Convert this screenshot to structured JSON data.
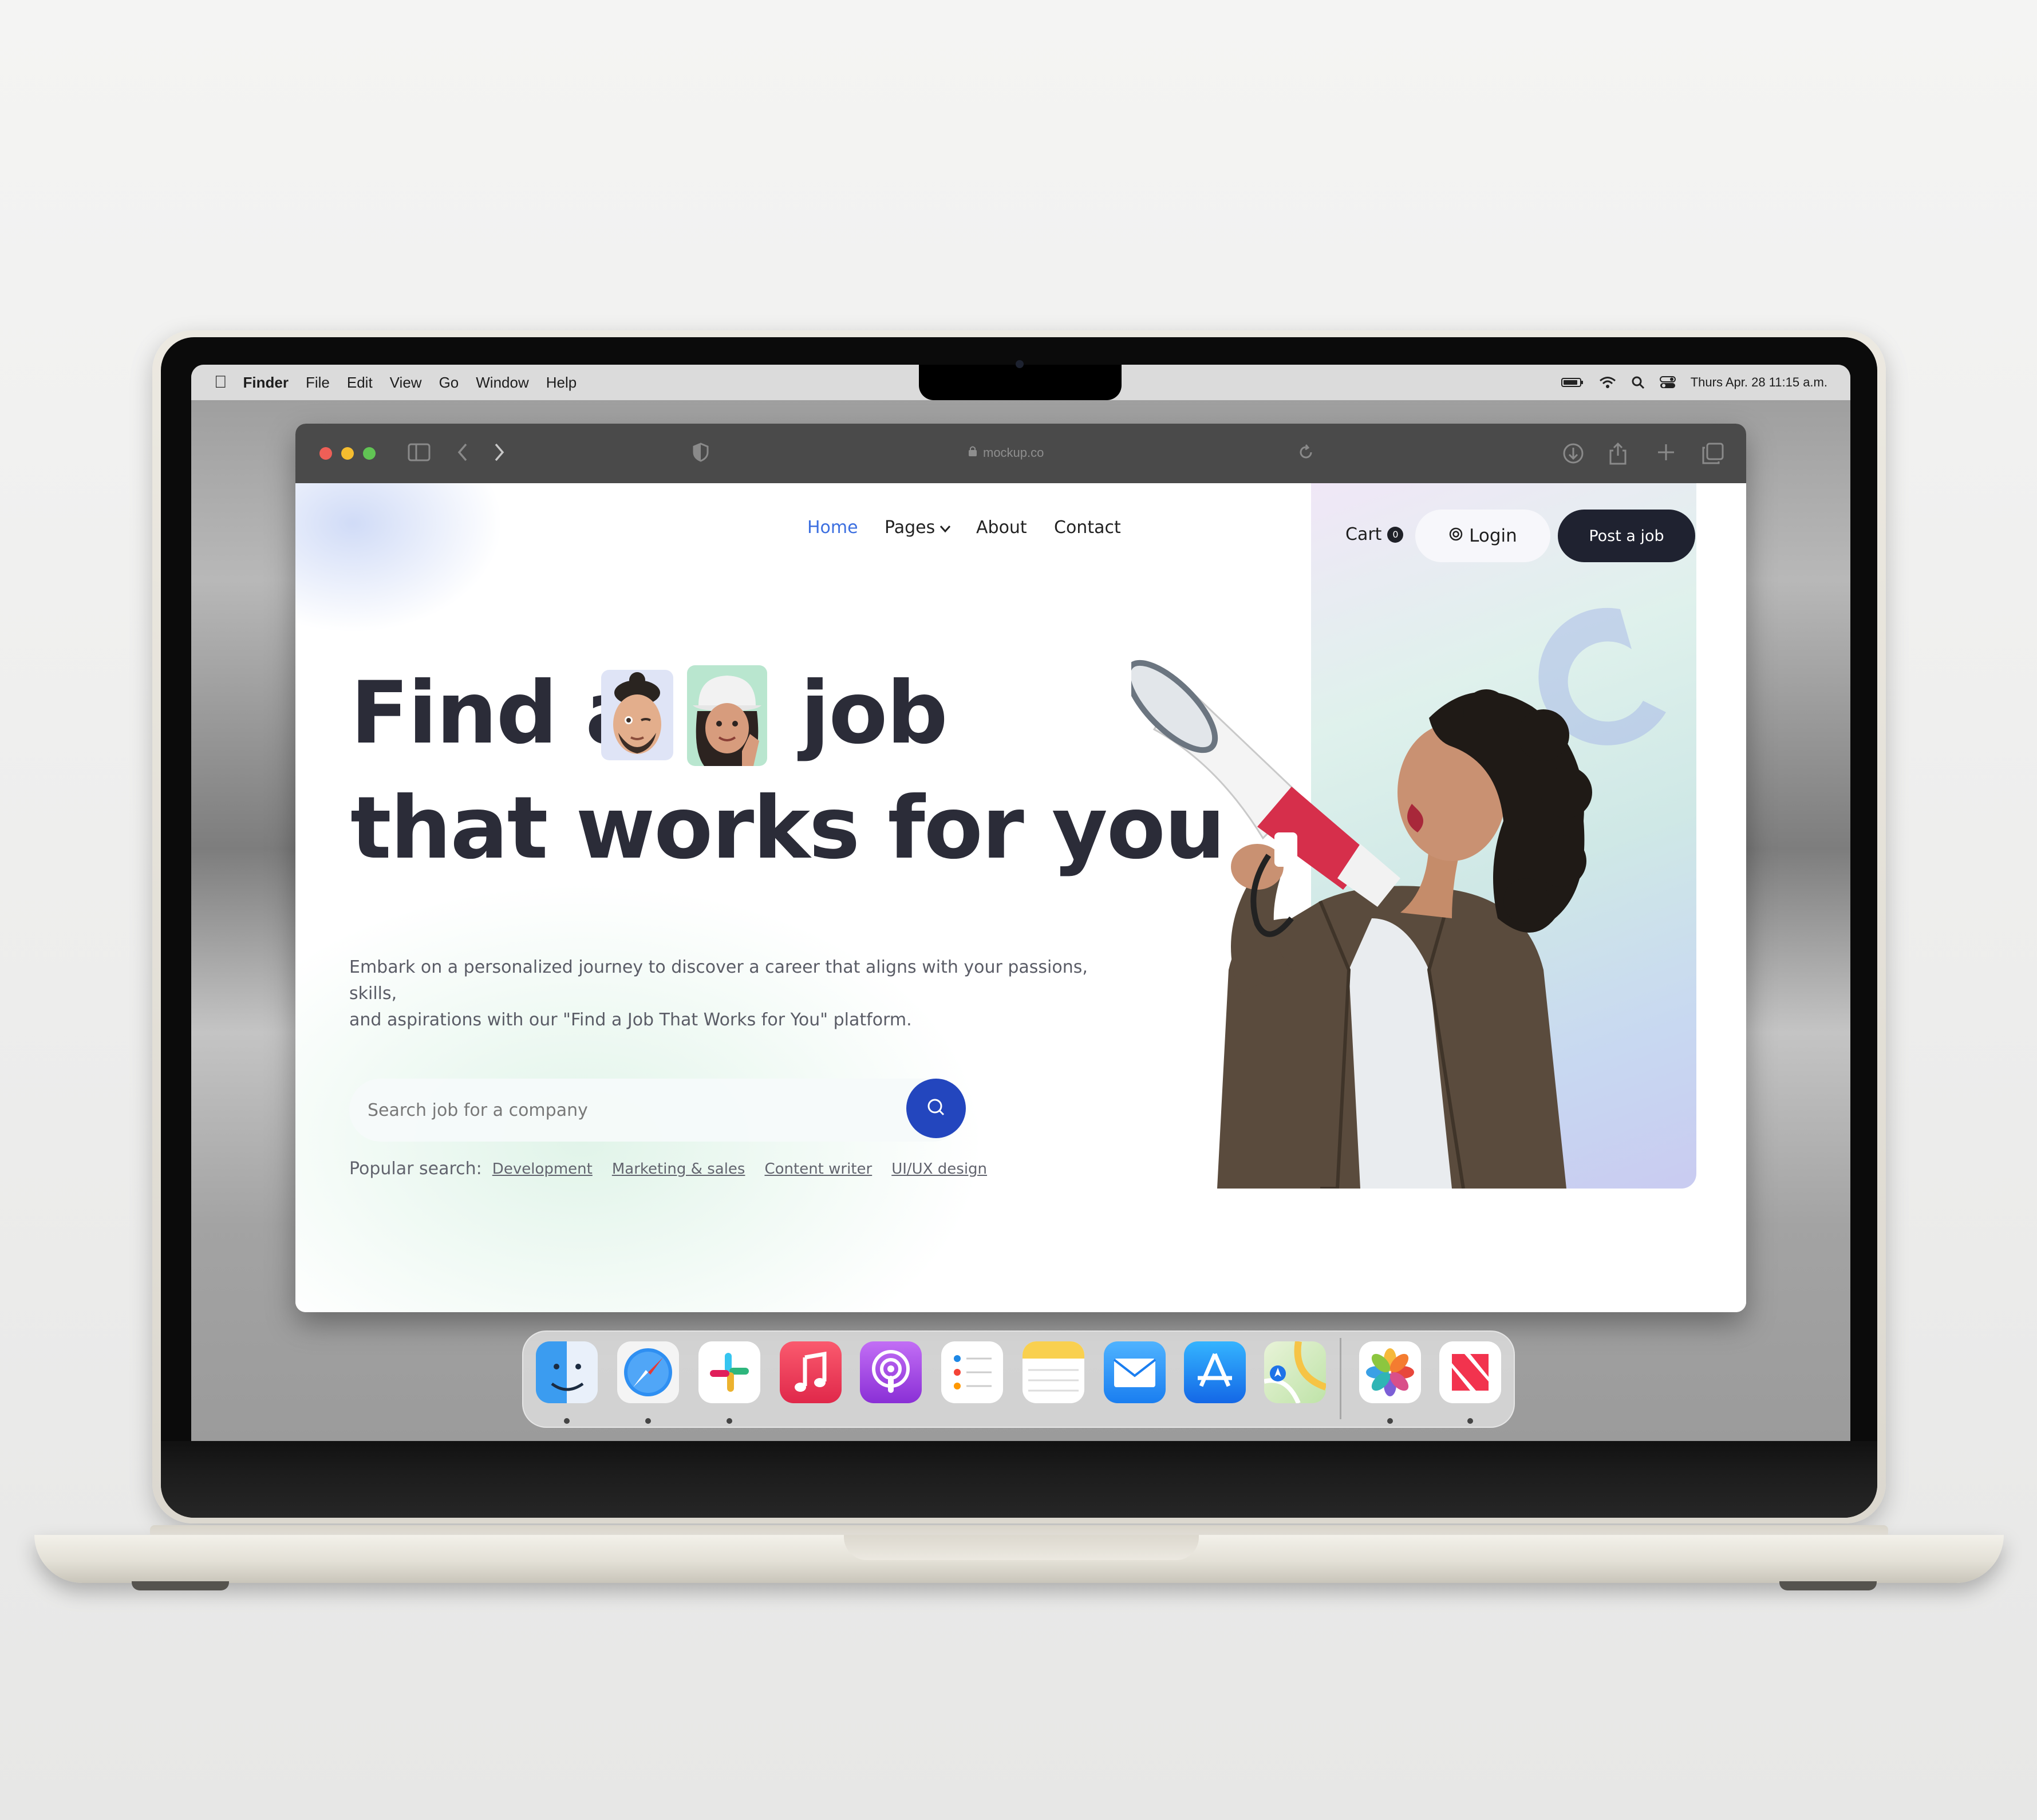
{
  "menubar": {
    "app": "Finder",
    "items": [
      "File",
      "Edit",
      "View",
      "Go",
      "Window",
      "Help"
    ],
    "datetime": "Thurs Apr. 28 11:15 a.m."
  },
  "browser": {
    "url": "mockup.co"
  },
  "nav": {
    "items": [
      "Home",
      "Pages",
      "About",
      "Contact"
    ],
    "active": "Home",
    "cart_label": "Cart",
    "cart_count": "0",
    "login_label": "Login",
    "post_label": "Post a job"
  },
  "hero": {
    "line1_a": "Find a",
    "line1_b": "job",
    "line2": "that works for you",
    "description_1": "Embark on a personalized journey to discover a career that aligns with your passions, skills,",
    "description_2": "and aspirations with our \"Find a Job That Works for You\" platform.",
    "search_placeholder": "Search job for a company",
    "popular_label": "Popular search:",
    "popular_tags": [
      "Development",
      "Marketing & sales",
      "Content writer",
      "UI/UX design"
    ]
  },
  "dock": {
    "apps": [
      "finder-icon",
      "safari-icon",
      "slack-icon",
      "music-icon",
      "podcasts-icon",
      "reminders-icon",
      "notes-icon",
      "mail-icon",
      "app-store-icon",
      "maps-icon",
      "photos-icon",
      "news-icon"
    ]
  },
  "colors": {
    "accent": "#3c6fe0",
    "search_button": "#2346be",
    "dark_button": "#1f2230",
    "heading": "#2b2c38"
  }
}
